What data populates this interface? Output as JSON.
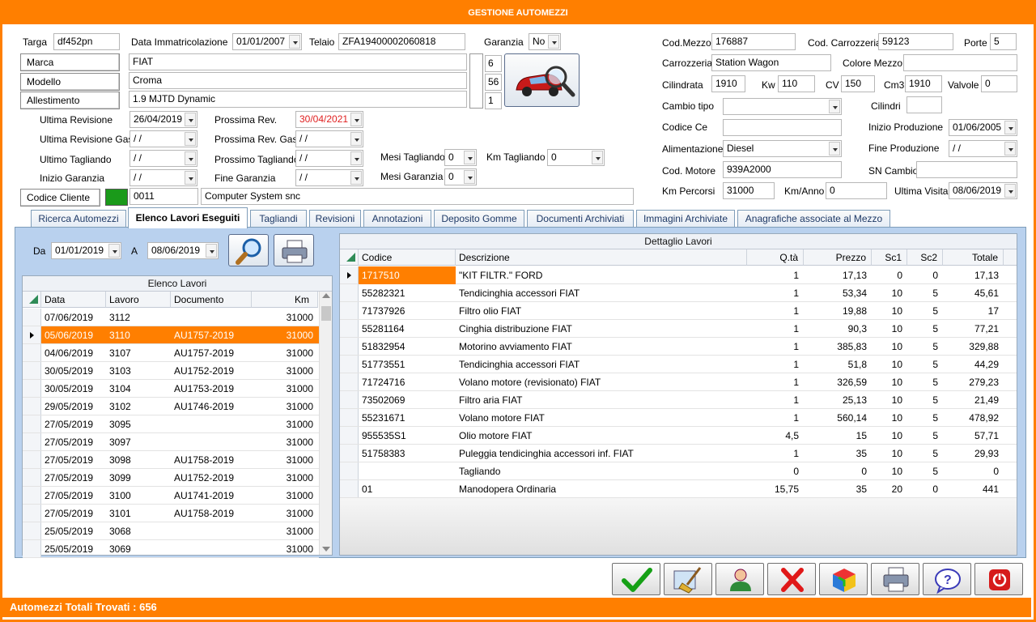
{
  "window": {
    "title": "GESTIONE AUTOMEZZI"
  },
  "top": {
    "targa_label": "Targa",
    "targa": "df452pn",
    "data_imm_label": "Data Immatricolazione",
    "data_imm": "01/01/2007",
    "telaio_label": "Telaio",
    "telaio": "ZFA19400002060818",
    "garanzia_label": "Garanzia",
    "garanzia": "No",
    "marca_label": "Marca",
    "marca": "FIAT",
    "marca_code": "6",
    "modello_label": "Modello",
    "modello": "Croma",
    "modello_code": "56",
    "allestimento_label": "Allestimento",
    "allestimento": "1.9 MJTD Dynamic",
    "allestimento_code": "1",
    "ultima_rev_label": "Ultima Revisione",
    "ultima_rev": "26/04/2019",
    "prossima_rev_label": "Prossima Rev.",
    "prossima_rev": "30/04/2021",
    "ultima_rev_gas_label": "Ultima Revisione Gas",
    "ultima_rev_gas": " / /",
    "prossima_rev_gas_label": "Prossima Rev. Gas",
    "prossima_rev_gas": " / /",
    "ultimo_tagliando_label": "Ultimo Tagliando",
    "ultimo_tagliando": " / /",
    "prossimo_tagliando_label": "Prossimo Tagliando",
    "prossimo_tagliando": " / /",
    "inizio_garanzia_label": "Inizio Garanzia",
    "inizio_garanzia": " / /",
    "fine_garanzia_label": "Fine Garanzia",
    "fine_garanzia": " / /",
    "mesi_tagliando_label": "Mesi Tagliando",
    "mesi_tagliando": "0",
    "km_tagliando_label": "Km Tagliando",
    "km_tagliando": "0",
    "mesi_garanzia_label": "Mesi Garanzia",
    "mesi_garanzia": "0",
    "codice_cliente_label": "Codice Cliente",
    "codice_cliente": "0011",
    "cliente_nome": "Computer System snc"
  },
  "right": {
    "cod_mezzo_label": "Cod.Mezzo",
    "cod_mezzo": "176887",
    "cod_carrozzeria_label": "Cod. Carrozzeria",
    "cod_carrozzeria": "59123",
    "porte_label": "Porte",
    "porte": "5",
    "carrozzeria_label": "Carrozzeria",
    "carrozzeria": "Station Wagon",
    "colore_label": "Colore Mezzo",
    "colore": "",
    "cilindrata_label": "Cilindrata",
    "cilindrata": "1910",
    "kw_label": "Kw",
    "kw": "110",
    "cv_label": "CV",
    "cv": "150",
    "cm3_label": "Cm3",
    "cm3": "1910",
    "valvole_label": "Valvole",
    "valvole": "0",
    "cambio_tipo_label": "Cambio tipo",
    "cambio_tipo": "",
    "cilindri_label": "Cilindri",
    "cilindri": "",
    "codice_ce_label": "Codice Ce",
    "codice_ce": "",
    "inizio_prod_label": "Inizio Produzione",
    "inizio_prod": "01/06/2005",
    "alimentazione_label": "Alimentazione",
    "alimentazione": "Diesel",
    "fine_prod_label": "Fine Produzione",
    "fine_prod": " / /",
    "cod_motore_label": "Cod. Motore",
    "cod_motore": "939A2000",
    "sn_cambio_label": "SN Cambio",
    "sn_cambio": "",
    "km_percorsi_label": "Km Percorsi",
    "km_percorsi": "31000",
    "km_anno_label": "Km/Anno",
    "km_anno": "0",
    "ultima_visita_label": "Ultima Visita",
    "ultima_visita": "08/06/2019"
  },
  "tabs": [
    {
      "label": "Ricerca Automezzi"
    },
    {
      "label": "Elenco Lavori Eseguiti"
    },
    {
      "label": "Tagliandi"
    },
    {
      "label": "Revisioni"
    },
    {
      "label": "Annotazioni"
    },
    {
      "label": "Deposito Gomme"
    },
    {
      "label": "Documenti Archiviati"
    },
    {
      "label": "Immagini Archiviate"
    },
    {
      "label": "Anagrafiche associate al Mezzo"
    }
  ],
  "filter": {
    "da_label": "Da",
    "da": "01/01/2019",
    "a_label": "A",
    "a": "08/06/2019"
  },
  "elenco": {
    "title": "Elenco Lavori",
    "columns": [
      "Data",
      "Lavoro",
      "Documento",
      "Km"
    ],
    "rows": [
      [
        "07/06/2019",
        "3112",
        "",
        "31000"
      ],
      [
        "05/06/2019",
        "3110",
        "AU1757-2019",
        "31000"
      ],
      [
        "04/06/2019",
        "3107",
        "AU1757-2019",
        "31000"
      ],
      [
        "30/05/2019",
        "3103",
        "AU1752-2019",
        "31000"
      ],
      [
        "30/05/2019",
        "3104",
        "AU1753-2019",
        "31000"
      ],
      [
        "29/05/2019",
        "3102",
        "AU1746-2019",
        "31000"
      ],
      [
        "27/05/2019",
        "3095",
        "",
        "31000"
      ],
      [
        "27/05/2019",
        "3097",
        "",
        "31000"
      ],
      [
        "27/05/2019",
        "3098",
        "AU1758-2019",
        "31000"
      ],
      [
        "27/05/2019",
        "3099",
        "AU1752-2019",
        "31000"
      ],
      [
        "27/05/2019",
        "3100",
        "AU1741-2019",
        "31000"
      ],
      [
        "27/05/2019",
        "3101",
        "AU1758-2019",
        "31000"
      ],
      [
        "25/05/2019",
        "3068",
        "",
        "31000"
      ],
      [
        "25/05/2019",
        "3069",
        "",
        "31000"
      ]
    ],
    "selected_index": 1
  },
  "dettaglio": {
    "title": "Dettaglio Lavori",
    "columns": [
      "Codice",
      "Descrizione",
      "Q.tà",
      "Prezzo",
      "Sc1",
      "Sc2",
      "Totale"
    ],
    "rows": [
      [
        "1717510",
        "\"KIT FILTR.\" FORD",
        "1",
        "17,13",
        "0",
        "0",
        "17,13"
      ],
      [
        "55282321",
        "Tendicinghia accessori FIAT",
        "1",
        "53,34",
        "10",
        "5",
        "45,61"
      ],
      [
        "71737926",
        "Filtro olio FIAT",
        "1",
        "19,88",
        "10",
        "5",
        "17"
      ],
      [
        "55281164",
        "Cinghia distribuzione FIAT",
        "1",
        "90,3",
        "10",
        "5",
        "77,21"
      ],
      [
        "51832954",
        "Motorino avviamento FIAT",
        "1",
        "385,83",
        "10",
        "5",
        "329,88"
      ],
      [
        "51773551",
        "Tendicinghia accessori FIAT",
        "1",
        "51,8",
        "10",
        "5",
        "44,29"
      ],
      [
        "71724716",
        "Volano motore (revisionato) FIAT",
        "1",
        "326,59",
        "10",
        "5",
        "279,23"
      ],
      [
        "73502069",
        "Filtro aria FIAT",
        "1",
        "25,13",
        "10",
        "5",
        "21,49"
      ],
      [
        "55231671",
        "Volano motore FIAT",
        "1",
        "560,14",
        "10",
        "5",
        "478,92"
      ],
      [
        "955535S1",
        "Olio motore FIAT",
        "4,5",
        "15",
        "10",
        "5",
        "57,71"
      ],
      [
        "51758383",
        "Puleggia tendicinghia accessori inf. FIAT",
        "1",
        "35",
        "10",
        "5",
        "29,93"
      ],
      [
        "",
        "Tagliando",
        "0",
        "0",
        "10",
        "5",
        "0"
      ],
      [
        "01",
        "Manodopera Ordinaria",
        "15,75",
        "35",
        "20",
        "0",
        "441"
      ]
    ],
    "selected_index": 0
  },
  "status": {
    "text": "Automezzi Totali Trovati : 656"
  },
  "colors": {
    "accent": "#ff7f00",
    "panel": "#b9d1ee",
    "warn": "#e02020",
    "cliente_color": "#1a9a1a"
  }
}
